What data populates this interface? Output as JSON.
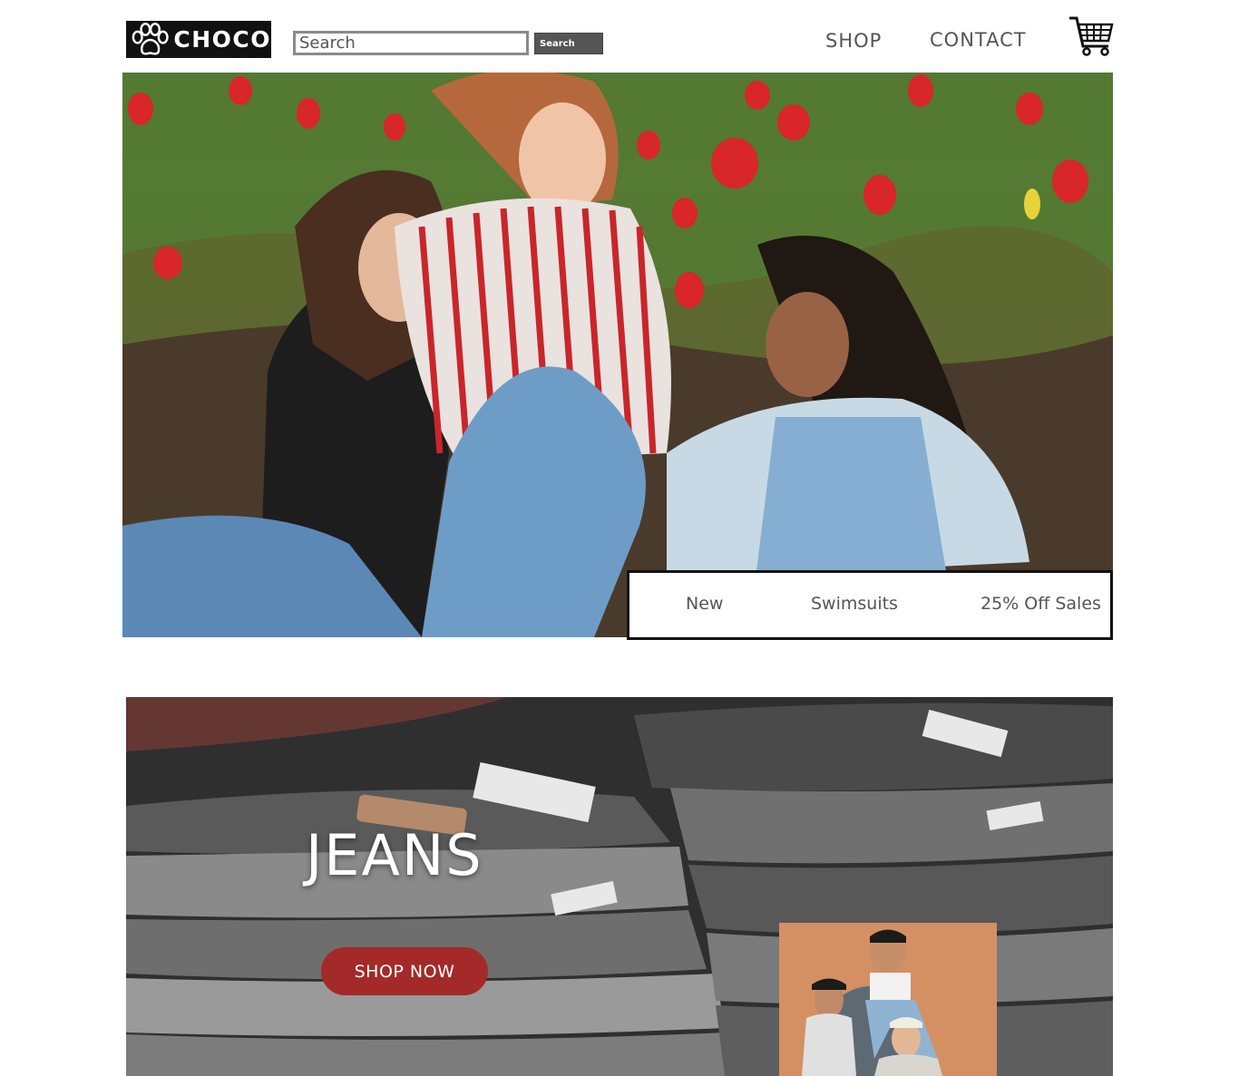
{
  "header": {
    "logo_text": "CHOCO",
    "logo_icon": "paw-icon",
    "search": {
      "placeholder": "Search",
      "button_label": "Search"
    },
    "nav": {
      "shop": "SHOP",
      "contact": "CONTACT"
    },
    "cart_icon": "shopping-cart-icon"
  },
  "hero": {
    "categories": [
      "New",
      "Swimsuits",
      "25% Off Sales"
    ]
  },
  "banner": {
    "title": "JEANS",
    "cta": "SHOP NOW",
    "accent_color": "#a32a28"
  }
}
